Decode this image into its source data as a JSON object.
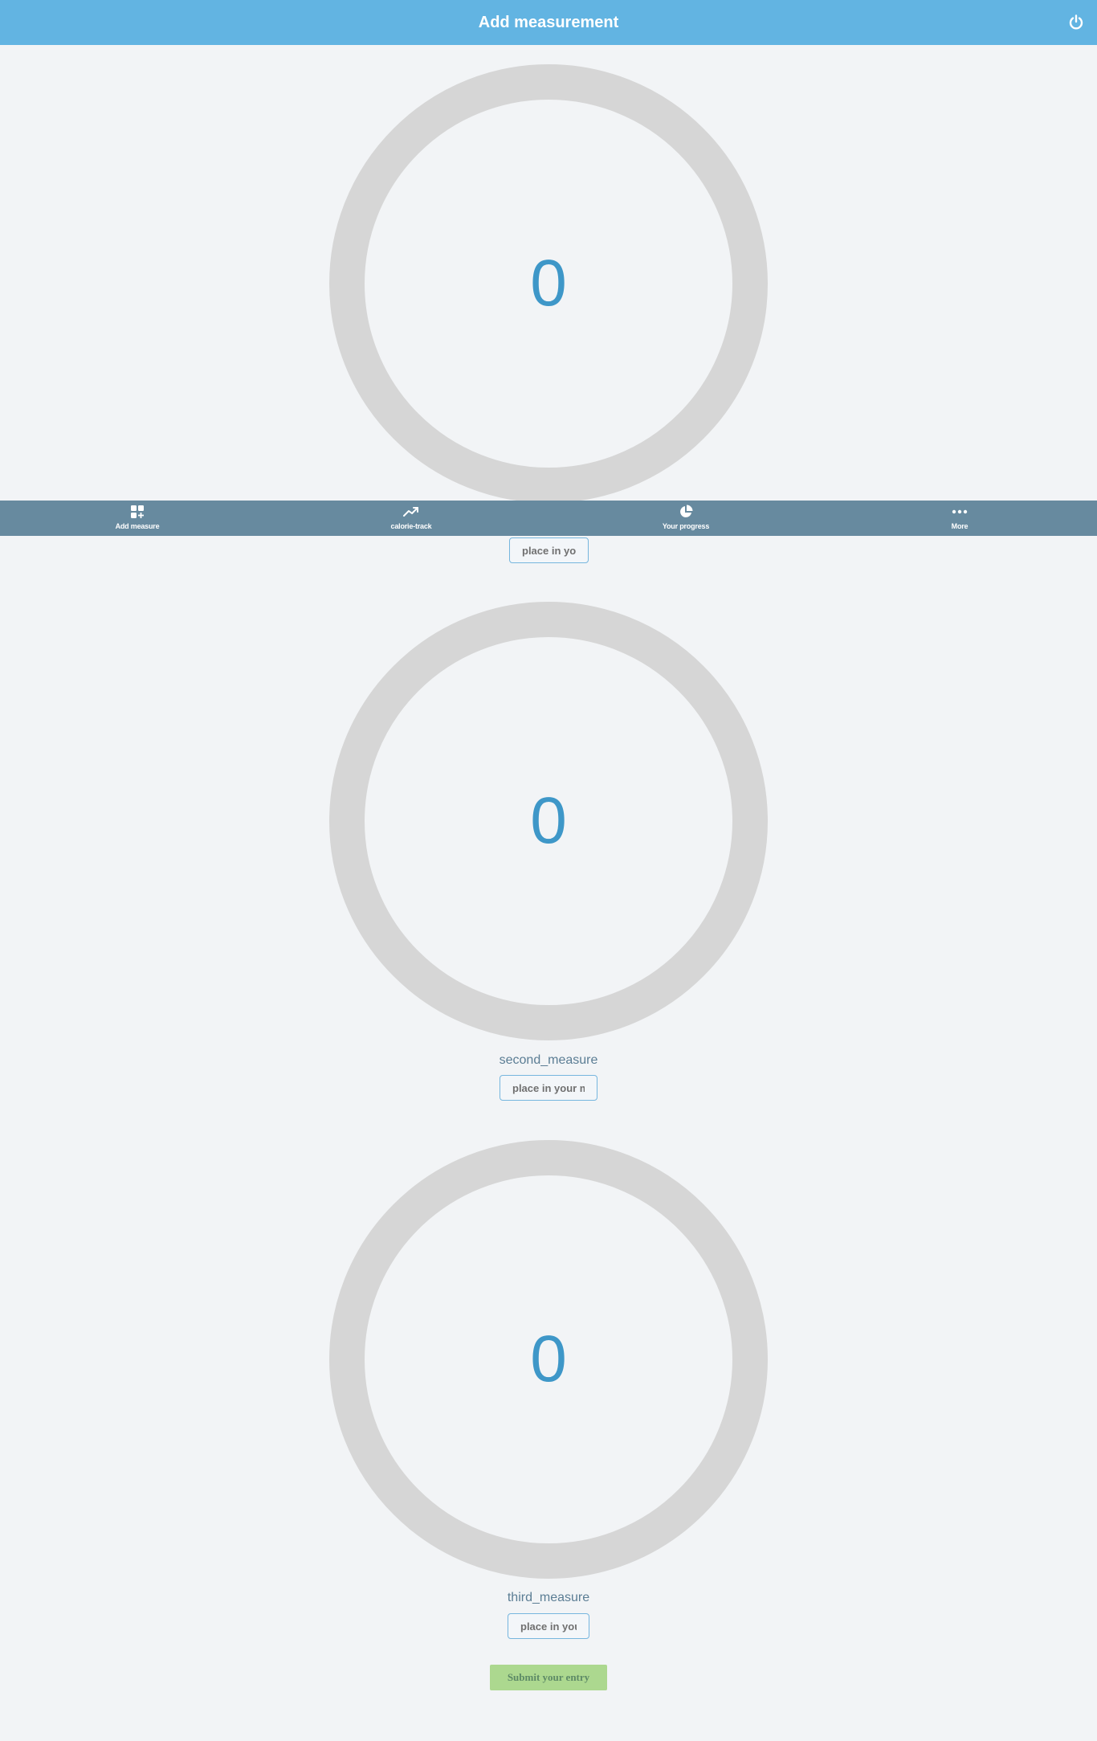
{
  "header": {
    "title": "Add measurement",
    "power_icon": "power-icon"
  },
  "measures": [
    {
      "value": "0",
      "label": "",
      "placeholder": "place in your measurement"
    },
    {
      "value": "0",
      "label": "second_measure",
      "placeholder": "place in your measurement"
    },
    {
      "value": "0",
      "label": "third_measure",
      "placeholder": "place in your measurement"
    }
  ],
  "submit_label": "Submit your entry",
  "tabbar": {
    "items": [
      {
        "label": "Add measure",
        "icon": "grid-plus-icon"
      },
      {
        "label": "calorie-track",
        "icon": "trending-up-icon"
      },
      {
        "label": "Your progress",
        "icon": "pie-chart-icon"
      },
      {
        "label": "More",
        "icon": "more-dots-icon"
      }
    ]
  },
  "colors": {
    "header_bg": "#62b4e2",
    "tabbar_bg": "#678a9f",
    "gauge_ring": "#d6d6d6",
    "gauge_value": "#3e97c8",
    "submit_bg": "#acd88f",
    "page_bg": "#f2f4f6"
  }
}
